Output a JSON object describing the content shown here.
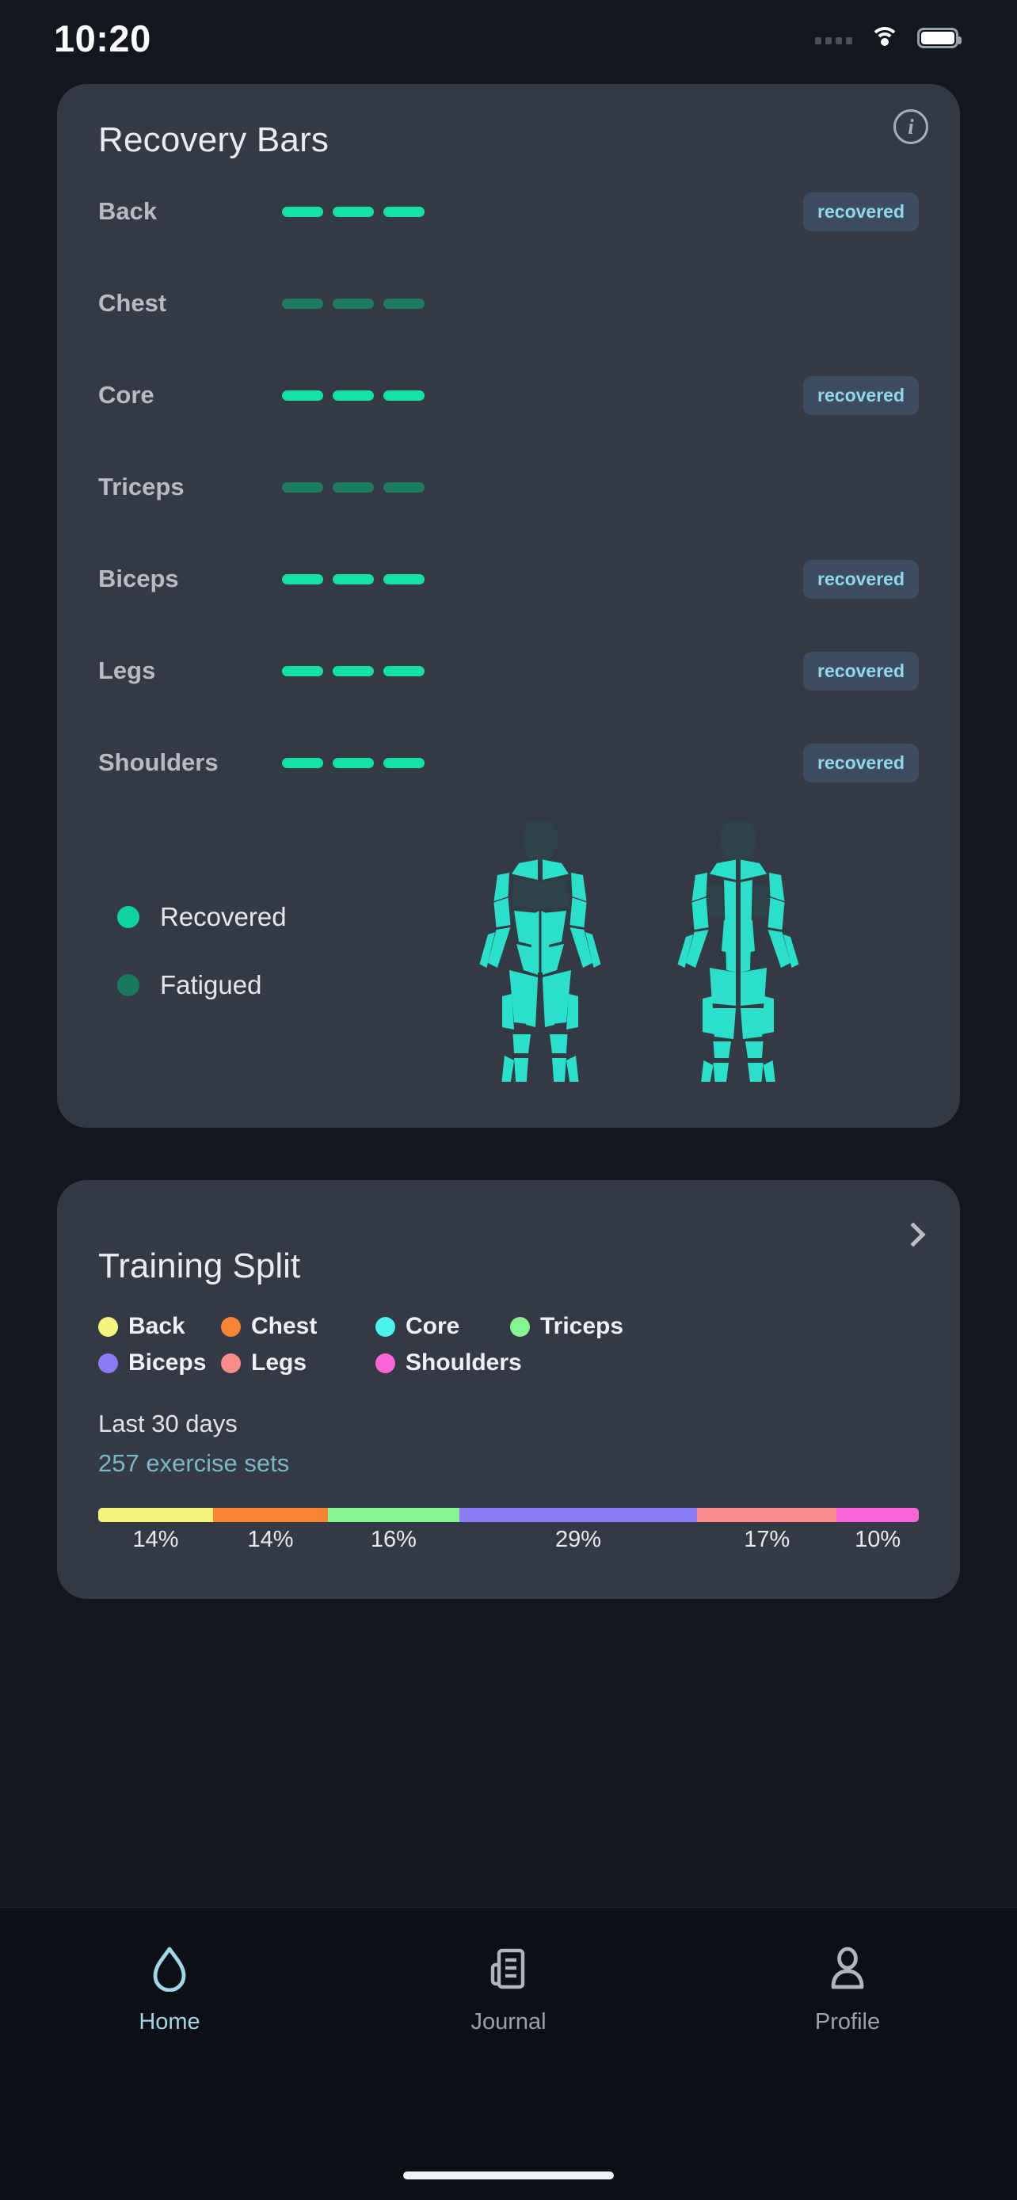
{
  "status_bar": {
    "time": "10:20",
    "signal_icon": "signal-dots-icon",
    "wifi_icon": "wifi-icon",
    "battery_icon": "battery-full-icon"
  },
  "recovery_card": {
    "title": "Recovery Bars",
    "info_icon": "info-circle-icon",
    "info_glyph": "i",
    "colors": {
      "recovered_bar": "#14e2a5",
      "fatigued_bar": "#1d7d60",
      "badge_bg": "#3e4c61",
      "badge_text": "#8fd9ee",
      "card_bg": "#343a45"
    },
    "muscles": [
      {
        "name": "Back",
        "status": "recovered",
        "badge": "recovered",
        "bars": 3,
        "filled": 3
      },
      {
        "name": "Chest",
        "status": "fatigued",
        "badge": "",
        "bars": 3,
        "filled": 0
      },
      {
        "name": "Core",
        "status": "recovered",
        "badge": "recovered",
        "bars": 3,
        "filled": 3
      },
      {
        "name": "Triceps",
        "status": "fatigued",
        "badge": "",
        "bars": 3,
        "filled": 0
      },
      {
        "name": "Biceps",
        "status": "recovered",
        "badge": "recovered",
        "bars": 3,
        "filled": 3
      },
      {
        "name": "Legs",
        "status": "recovered",
        "badge": "recovered",
        "bars": 3,
        "filled": 3
      },
      {
        "name": "Shoulders",
        "status": "recovered",
        "badge": "recovered",
        "bars": 3,
        "filled": 3
      }
    ],
    "legend": [
      {
        "label": "Recovered",
        "color": "#0fd3a0"
      },
      {
        "label": "Fatigued",
        "color": "#177a5f"
      }
    ],
    "figures": [
      {
        "view": "anterior",
        "recovered_color": "#2ae0cd",
        "fatigued_color": "#2d4249"
      },
      {
        "view": "posterior",
        "recovered_color": "#2ae0cd",
        "fatigued_color": "#2d4249"
      }
    ]
  },
  "training_split": {
    "title": "Training Split",
    "chevron_icon": "chevron-right-icon",
    "legend": [
      {
        "label": "Back",
        "color": "#f5f57d"
      },
      {
        "label": "Chest",
        "color": "#fa8334"
      },
      {
        "label": "Core",
        "color": "#4cf2f2"
      },
      {
        "label": "Triceps",
        "color": "#86f58f"
      },
      {
        "label": "Biceps",
        "color": "#8b7cf8"
      },
      {
        "label": "Legs",
        "color": "#fa8b8b"
      },
      {
        "label": "Shoulders",
        "color": "#fa65d9"
      }
    ],
    "period_label": "Last 30 days",
    "sets_label": "257 exercise sets",
    "chart_data": {
      "type": "bar",
      "subtype": "stacked-horizontal-100",
      "title": "Training Split",
      "subtitle": "Last 30 days",
      "annotation": "257 exercise sets",
      "total_sets": 257,
      "categories": [
        "Back",
        "Chest",
        "Triceps",
        "Biceps",
        "Legs",
        "Shoulders"
      ],
      "values": [
        14,
        14,
        16,
        29,
        17,
        10
      ],
      "labels": [
        "14%",
        "14%",
        "16%",
        "29%",
        "17%",
        "10%"
      ],
      "colors": [
        "#f5f57d",
        "#fa8334",
        "#86f58f",
        "#8b7cf8",
        "#fa8b8b",
        "#fa65d9"
      ],
      "unit": "%",
      "xlabel": "",
      "ylabel": "",
      "ylim": [
        0,
        100
      ],
      "grid": false,
      "legend_position": "top"
    }
  },
  "bottom_nav": {
    "items": [
      {
        "label": "Home",
        "icon": "home-icon",
        "active": true
      },
      {
        "label": "Journal",
        "icon": "journal-icon",
        "active": false
      },
      {
        "label": "Profile",
        "icon": "profile-icon",
        "active": false
      }
    ]
  }
}
